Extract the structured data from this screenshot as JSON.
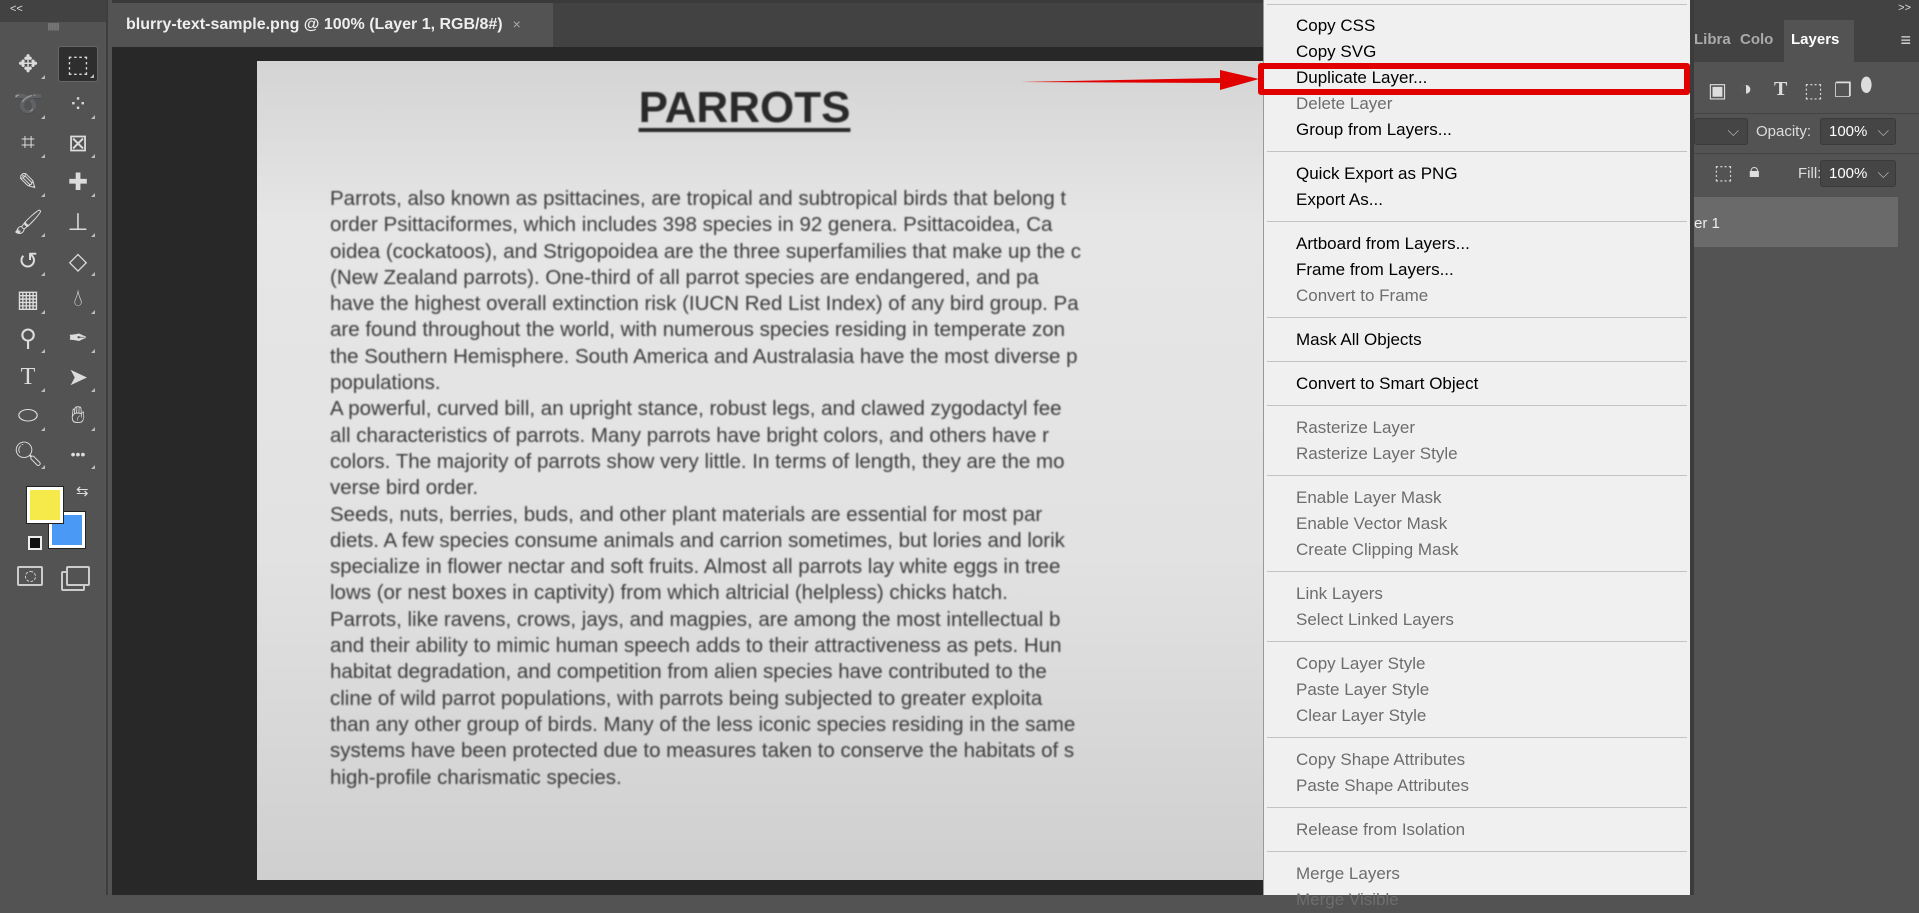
{
  "toolbar": {
    "collapse": "<<",
    "colors": {
      "foreground": "#f5ea4a",
      "background": "#4a99f5"
    },
    "tools": [
      "move-tool",
      "rectangular-marquee-tool",
      "lasso-tool",
      "object-selection-tool",
      "crop-tool",
      "frame-tool",
      "eyedropper-tool",
      "spot-healing-tool",
      "brush-tool",
      "clone-stamp-tool",
      "history-brush-tool",
      "eraser-tool",
      "gradient-tool",
      "blur-tool",
      "dodge-tool",
      "pen-tool",
      "type-tool",
      "path-selection-tool",
      "ellipse-tool",
      "hand-tool",
      "zoom-tool",
      "more-tools"
    ]
  },
  "document": {
    "tab_title": "blurry-text-sample.png @ 100% (Layer 1, RGB/8#)",
    "close": "×",
    "title": "PARROTS",
    "lines": [
      "Parrots, also known as psittacines, are tropical and subtropical birds that belong t",
      "order Psittaciformes, which includes 398 species in 92 genera. Psittacoidea, Ca",
      "oidea (cockatoos), and Strigopoidea are the three superfamilies that make up the c",
      "(New Zealand parrots). One-third of all parrot species are endangered, and pa",
      "have the highest overall extinction risk (IUCN Red List Index) of any bird group. Pa",
      "are found throughout the world, with numerous species residing in temperate zon",
      "the Southern Hemisphere. South America and Australasia have the most diverse p",
      "populations.",
      "A powerful, curved bill, an upright stance, robust legs, and clawed zygodactyl fee",
      "all characteristics of parrots. Many parrots have bright colors, and others have r",
      "colors. The majority of parrots show very little. In terms of length, they are the mo",
      "verse bird order.",
      "Seeds, nuts, berries, buds, and other plant materials are essential for most par",
      "diets. A few species consume animals and carrion sometimes, but lories and lorik",
      "specialize in flower nectar and soft fruits. Almost all parrots lay white eggs in tree",
      "lows (or nest boxes in captivity) from which altricial (helpless) chicks hatch.",
      "Parrots, like ravens, crows, jays, and magpies, are among the most intellectual b",
      "and their ability to mimic human speech adds to their attractiveness as pets. Hun",
      "habitat degradation, and competition from alien species have contributed to the",
      "cline of wild parrot populations, with parrots being subjected to greater exploita",
      "than any other group of birds. Many of the less iconic species residing in the same",
      "systems have been protected due to measures taken to conserve the habitats of s",
      "high-profile charismatic species."
    ]
  },
  "context_menu": {
    "highlight_color": "#e10000",
    "groups": [
      [
        {
          "label": "Copy CSS",
          "enabled": true
        },
        {
          "label": "Copy SVG",
          "enabled": true
        },
        {
          "label": "Duplicate Layer...",
          "enabled": true,
          "highlighted": true
        },
        {
          "label": "Delete Layer",
          "enabled": false
        },
        {
          "label": "Group from Layers...",
          "enabled": true
        }
      ],
      [
        {
          "label": "Quick Export as PNG",
          "enabled": true
        },
        {
          "label": "Export As...",
          "enabled": true
        }
      ],
      [
        {
          "label": "Artboard from Layers...",
          "enabled": true
        },
        {
          "label": "Frame from Layers...",
          "enabled": true
        },
        {
          "label": "Convert to Frame",
          "enabled": false
        }
      ],
      [
        {
          "label": "Mask All Objects",
          "enabled": true
        }
      ],
      [
        {
          "label": "Convert to Smart Object",
          "enabled": true
        }
      ],
      [
        {
          "label": "Rasterize Layer",
          "enabled": false
        },
        {
          "label": "Rasterize Layer Style",
          "enabled": false
        }
      ],
      [
        {
          "label": "Enable Layer Mask",
          "enabled": false
        },
        {
          "label": "Enable Vector Mask",
          "enabled": false
        },
        {
          "label": "Create Clipping Mask",
          "enabled": false
        }
      ],
      [
        {
          "label": "Link Layers",
          "enabled": false
        },
        {
          "label": "Select Linked Layers",
          "enabled": false
        }
      ],
      [
        {
          "label": "Copy Layer Style",
          "enabled": false
        },
        {
          "label": "Paste Layer Style",
          "enabled": false
        },
        {
          "label": "Clear Layer Style",
          "enabled": false
        }
      ],
      [
        {
          "label": "Copy Shape Attributes",
          "enabled": false
        },
        {
          "label": "Paste Shape Attributes",
          "enabled": false
        }
      ],
      [
        {
          "label": "Release from Isolation",
          "enabled": false
        }
      ],
      [
        {
          "label": "Merge Layers",
          "enabled": false
        },
        {
          "label": "Merge Visible",
          "enabled": false
        }
      ]
    ]
  },
  "panel": {
    "expand": ">>",
    "tabs": [
      {
        "label": "Libra"
      },
      {
        "label": "Colo"
      },
      {
        "label": "Layers",
        "active": true
      }
    ],
    "opacity_label": "Opacity:",
    "opacity": "100%",
    "fill_label": "Fill:",
    "fill": "100%",
    "layer_name": "er 1"
  }
}
